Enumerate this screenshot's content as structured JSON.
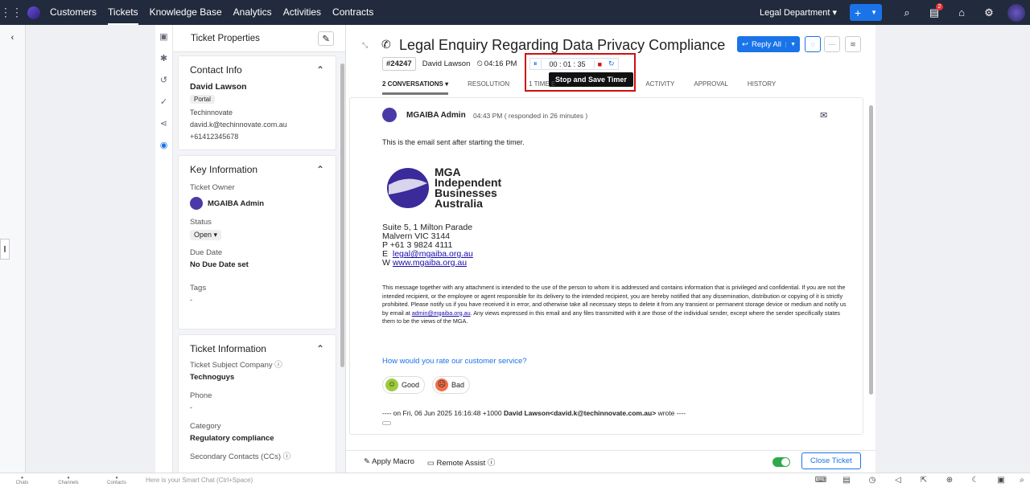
{
  "nav": {
    "items": [
      "Customers",
      "Tickets",
      "Knowledge Base",
      "Analytics",
      "Activities",
      "Contracts"
    ],
    "active": "Tickets",
    "department": "Legal Department",
    "notif_count": "2"
  },
  "props": {
    "header": "Ticket Properties",
    "contact": {
      "title": "Contact Info",
      "name": "David Lawson",
      "channel": "Portal",
      "company": "Techinnovate",
      "email": "david.k@techinnovate.com.au",
      "phone": "+61412345678"
    },
    "key": {
      "title": "Key Information",
      "owner_label": "Ticket Owner",
      "owner": "MGAIBA Admin",
      "status_label": "Status",
      "status": "Open",
      "due_label": "Due Date",
      "due": "No Due Date set",
      "tags_label": "Tags",
      "tags": "-"
    },
    "info": {
      "title": "Ticket Information",
      "company_label": "Ticket Subject Company",
      "company": "Technoguys",
      "phone_label": "Phone",
      "phone": "-",
      "category_label": "Category",
      "category": "Regulatory compliance",
      "cc_label": "Secondary Contacts (CCs)"
    }
  },
  "ticket": {
    "title": "Legal Enquiry Regarding Data Privacy Compliance",
    "id": "#24247",
    "contact": "David Lawson",
    "time": "04:16 PM",
    "timer": "00 : 01 : 35",
    "tooltip": "Stop and Save Timer",
    "reply": "Reply All",
    "tabs": [
      "2 CONVERSATIONS",
      "RESOLUTION",
      "1 TIME E",
      "ACTIVITY",
      "APPROVAL",
      "HISTORY"
    ]
  },
  "message": {
    "sender": "MGAIBA Admin",
    "time": "04:43 PM ( responded in 26 minutes )",
    "body": "This is the email sent after starting the timer.",
    "logo": "MGA Independent Businesses Australia",
    "addr1": "Suite 5, 1 Milton Parade",
    "addr2": "Malvern VIC  3144",
    "phone": "P +61 3 9824 4111",
    "email_prefix": "E",
    "email": "legal@mgaiba.org.au",
    "web_prefix": "W",
    "web": "www.mgaiba.org.au",
    "disclaimer_a": "This message together with any attachment is intended to the use of the person to whom it is addressed and contains information that is privileged and confidential. If you are not the intended recipient, or the employee or agent responsible for its delivery to the intended recipient, you are hereby notified that any dissemination, distribution or copying of it is strictly prohibited. Please notify us if you have received it in error, and otherwise take all necessary steps to delete it from any transient or permanent storage device or medium and notify us by email at ",
    "disclaimer_link": "admin@mgaiba.org.au",
    "disclaimer_b": ". Any views expressed in this email and any files transmitted with it are those of the individual sender, except where the sender specifically states them to be the views of the MGA.",
    "rate": "How would you rate our customer service?",
    "good": "Good",
    "bad": "Bad",
    "quote_a": "---- on Fri, 06 Jun 2025 16:16:48 +1000 ",
    "quote_b": "David Lawson<david.k@techinnovate.com.au>",
    "quote_c": " wrote ----"
  },
  "footer": {
    "macro": "Apply Macro",
    "remote": "Remote Assist",
    "close": "Close Ticket"
  },
  "bottom": {
    "chats": "Chats",
    "channels": "Channels",
    "contacts": "Contacts",
    "smartchat": "Here is your Smart Chat (Ctrl+Space)"
  },
  "colors": {
    "accent": "#1a73e8",
    "topbar": "#222a3d",
    "highlight": "#d01010"
  }
}
